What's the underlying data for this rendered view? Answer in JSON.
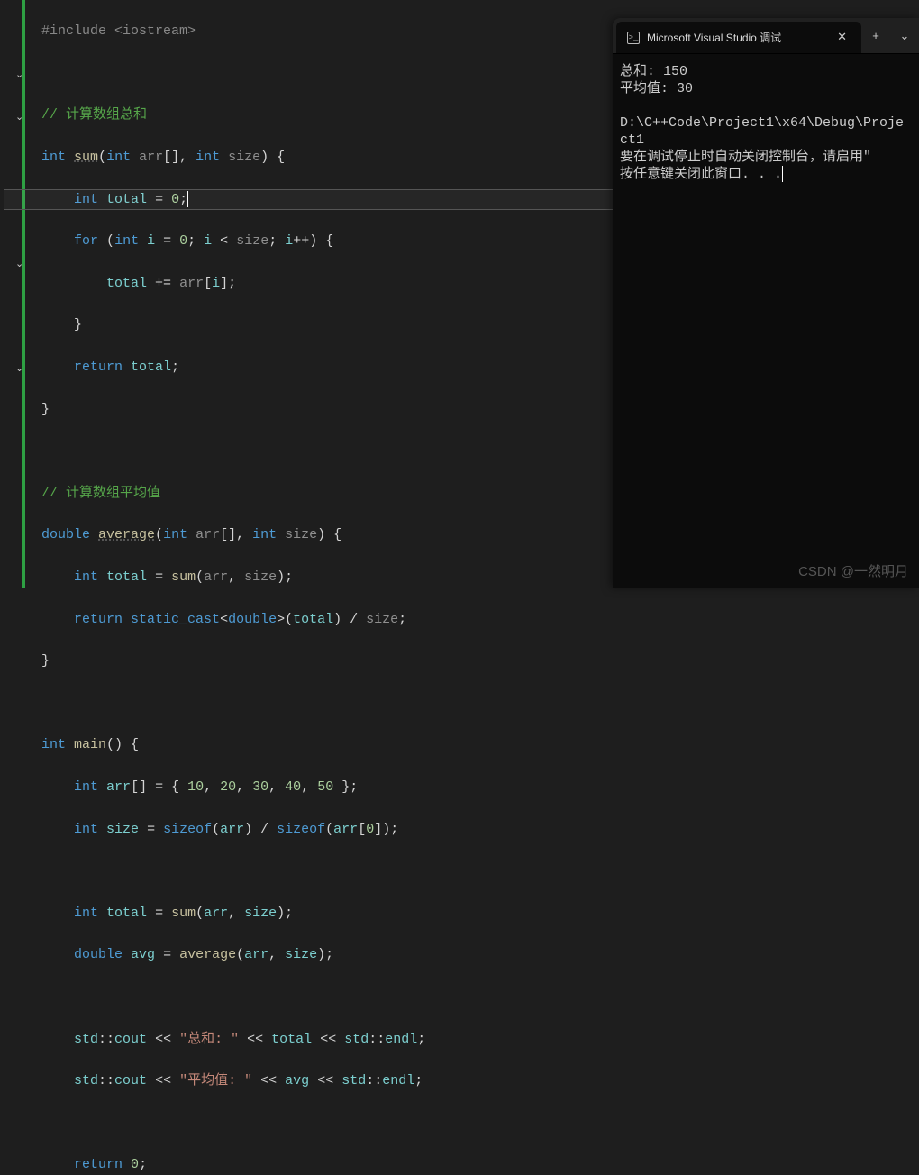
{
  "code": {
    "l1": "#include <iostream>",
    "comment_sum": "// 计算数组总和",
    "sum_sig": {
      "kw_int": "int",
      "fn": "sum",
      "p_int": "int",
      "p_arr": "arr",
      "p_size": "size"
    },
    "total_decl": {
      "kw": "int",
      "var": "total",
      "eq": "=",
      "val": "0"
    },
    "for_sig": {
      "kw_for": "for",
      "kw_int": "int",
      "i": "i",
      "zero": "0",
      "size": "size",
      "inc": "i++"
    },
    "total_add": {
      "total": "total",
      "arr": "arr",
      "i": "i"
    },
    "return_total": {
      "kw": "return",
      "var": "total"
    },
    "comment_avg": "// 计算数组平均值",
    "avg_sig": {
      "kw_double": "double",
      "fn": "average",
      "kw_int": "int",
      "arr": "arr",
      "size": "size"
    },
    "avg_total": {
      "kw": "int",
      "total": "total",
      "sum": "sum",
      "arr": "arr",
      "size": "size"
    },
    "avg_return": {
      "kw": "return",
      "cast": "static_cast",
      "dbl": "double",
      "total": "total",
      "size": "size"
    },
    "main_sig": {
      "kw_int": "int",
      "fn": "main"
    },
    "arr_decl": {
      "kw": "int",
      "arr": "arr",
      "v1": "10",
      "v2": "20",
      "v3": "30",
      "v4": "40",
      "v5": "50"
    },
    "size_decl": {
      "kw": "int",
      "size": "size",
      "sizeof": "sizeof",
      "arr": "arr",
      "zero": "0"
    },
    "main_total": {
      "kw": "int",
      "total": "total",
      "sum": "sum",
      "arr": "arr",
      "size": "size"
    },
    "main_avg": {
      "kw": "double",
      "avg": "avg",
      "average": "average",
      "arr": "arr",
      "size": "size"
    },
    "cout1": {
      "std": "std",
      "cout": "cout",
      "str": "\"总和: \"",
      "total": "total",
      "endl": "endl"
    },
    "cout2": {
      "std": "std",
      "cout": "cout",
      "str": "\"平均值: \"",
      "avg": "avg",
      "endl": "endl"
    },
    "return0": {
      "kw": "return",
      "val": "0"
    }
  },
  "console": {
    "tab_title": "Microsoft Visual Studio 调试",
    "line1": "总和: 150",
    "line2": "平均值: 30",
    "line3": "",
    "line4": "D:\\C++Code\\Project1\\x64\\Debug\\Project1",
    "line5": "要在调试停止时自动关闭控制台，请启用\"",
    "line6": "按任意键关闭此窗口. . ."
  },
  "watermark": "CSDN @一然明月"
}
